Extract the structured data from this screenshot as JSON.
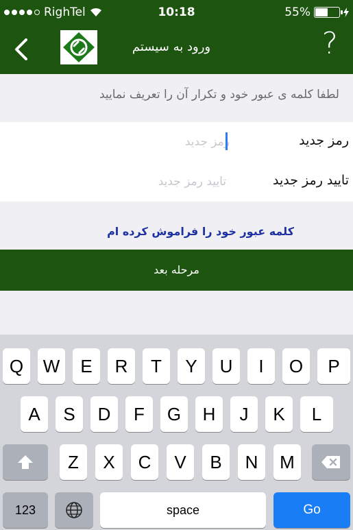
{
  "status_bar": {
    "carrier": "RighTel",
    "time": "10:18",
    "battery": "55%",
    "battery_level": 0.55
  },
  "navbar": {
    "title": "ورود به سیستم",
    "help": "?"
  },
  "instruction": "لطفا کلمه ی عبور خود و تکرار آن را تعریف نمایید",
  "form": {
    "new_password": {
      "label": "رمز جدید",
      "placeholder": "رمز جدید"
    },
    "confirm_password": {
      "label": "تایید رمز جدید",
      "placeholder": "تایید رمز جدید"
    }
  },
  "forgot_link": "کلمه عبور خود را فراموش کرده ام",
  "next_button": "مرحله بعد",
  "keyboard": {
    "row1": [
      "Q",
      "W",
      "E",
      "R",
      "T",
      "Y",
      "U",
      "I",
      "O",
      "P"
    ],
    "row2": [
      "A",
      "S",
      "D",
      "F",
      "G",
      "H",
      "J",
      "K",
      "L"
    ],
    "row3": [
      "Z",
      "X",
      "C",
      "V",
      "B",
      "N",
      "M"
    ],
    "numbers_key": "123",
    "space_key": "space",
    "go_key": "Go"
  }
}
